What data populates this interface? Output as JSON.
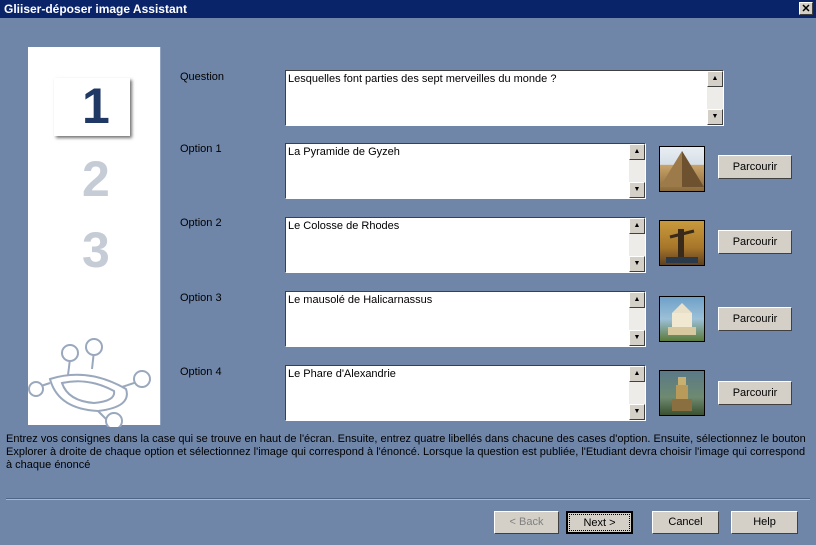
{
  "window": {
    "title": "Gliiser-déposer image Assistant",
    "close_glyph": "✕"
  },
  "steps": {
    "one": "1",
    "two": "2",
    "three": "3"
  },
  "question": {
    "label": "Question",
    "value": "Lesquelles font parties des sept merveilles du monde ?"
  },
  "options": [
    {
      "label": "Option 1",
      "value": "La Pyramide de Gyzeh",
      "browse": "Parcourir"
    },
    {
      "label": "Option 2",
      "value": "Le Colosse de Rhodes",
      "browse": "Parcourir"
    },
    {
      "label": "Option 3",
      "value": "Le mausolé de Halicarnassus",
      "browse": "Parcourir"
    },
    {
      "label": "Option 4",
      "value": "Le Phare d'Alexandrie",
      "browse": "Parcourir"
    }
  ],
  "instructions": "Entrez vos consignes dans la case qui se trouve en haut de l'écran. Ensuite, entrez quatre libellés dans chacune des cases d'option. Ensuite, sélectionnez le bouton Explorer à droite de chaque option et sélectionnez l'image qui correspond à l'énoncé. Lorsque la question est publiée, l'Etudiant devra choisir l'image qui correspond à chaque énoncé",
  "footer": {
    "back": "< Back",
    "next": "Next >",
    "cancel": "Cancel",
    "help": "Help"
  },
  "colors": {
    "background": "#6F86A9",
    "titlebar": "#0A246A",
    "step_active": "#1F3864",
    "step_inactive": "#C6CCD6"
  }
}
